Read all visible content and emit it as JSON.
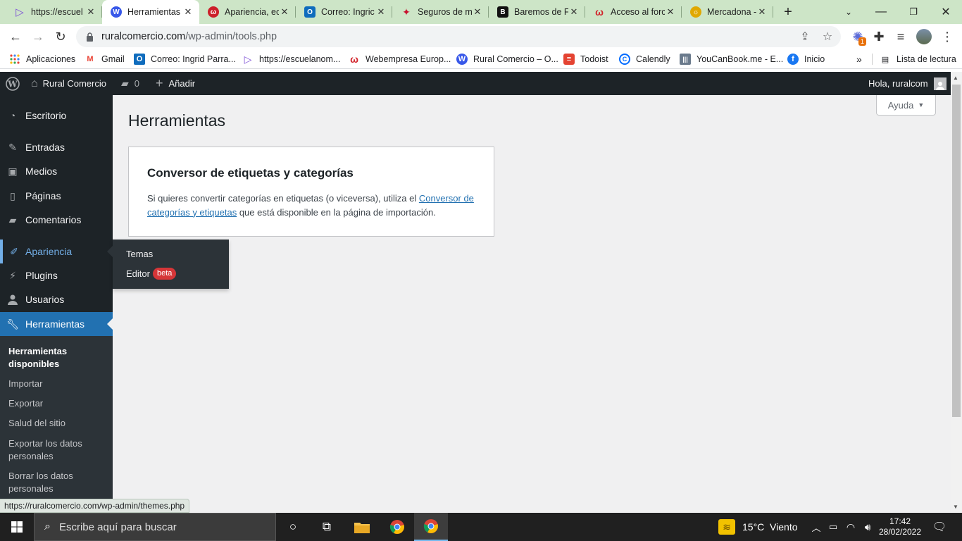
{
  "browser": {
    "tabs": [
      {
        "title": "https://escuel",
        "fav_color": "#7b4dd6",
        "fav_glyph": "▷"
      },
      {
        "title": "Herramientas",
        "fav_color": "#3858e9",
        "fav_glyph": "W"
      },
      {
        "title": "Apariencia, ec",
        "fav_color": "#cc1f2a",
        "fav_glyph": "ω"
      },
      {
        "title": "Correo: Ingric",
        "fav_color": "#0f6cbd",
        "fav_glyph": "O"
      },
      {
        "title": "Seguros de m",
        "fav_color": "#c8102e",
        "fav_glyph": "✦"
      },
      {
        "title": "Baremos de F",
        "fav_color": "#111111",
        "fav_glyph": "B"
      },
      {
        "title": "Acceso al forc",
        "fav_color": "#d2232a",
        "fav_glyph": "ω"
      },
      {
        "title": "Mercadona -",
        "fav_color": "#e0a800",
        "fav_glyph": "☼"
      }
    ],
    "url_domain": "ruralcomercio.com",
    "url_path": "/wp-admin/tools.php",
    "extension_badge": "1",
    "bookmarks": [
      "Aplicaciones",
      "Gmail",
      "Correo: Ingrid Parra...",
      "https://escuelanom...",
      "Webempresa Europ...",
      "Rural Comercio – O...",
      "Todoist",
      "Calendly",
      "YouCanBook.me - E...",
      "Inicio"
    ],
    "reading_list": "Lista de lectura"
  },
  "adminbar": {
    "site_name": "Rural Comercio",
    "comments_count": "0",
    "new_label": "Añadir",
    "greeting": "Hola, ruralcom"
  },
  "menu": {
    "items": [
      "Escritorio",
      "Entradas",
      "Medios",
      "Páginas",
      "Comentarios",
      "Apariencia",
      "Plugins",
      "Usuarios",
      "Herramientas"
    ],
    "submenu": [
      "Herramientas disponibles",
      "Importar",
      "Exportar",
      "Salud del sitio",
      "Exportar los datos personales",
      "Borrar los datos personales"
    ],
    "flyout": {
      "themes": "Temas",
      "editor": "Editor",
      "beta": "beta"
    }
  },
  "content": {
    "title": "Herramientas",
    "help": "Ayuda",
    "card_title": "Conversor de etiquetas y categorías",
    "card_text_before": "Si quieres convertir categorías en etiquetas (o viceversa), utiliza el ",
    "card_link": "Conversor de categorías y etiquetas",
    "card_text_after": " que está disponible en la página de importación."
  },
  "status_url": "https://ruralcomercio.com/wp-admin/themes.php",
  "taskbar": {
    "search_placeholder": "Escribe aquí para buscar",
    "weather": "15°C  Viento",
    "time": "17:42",
    "date": "28/02/2022"
  }
}
